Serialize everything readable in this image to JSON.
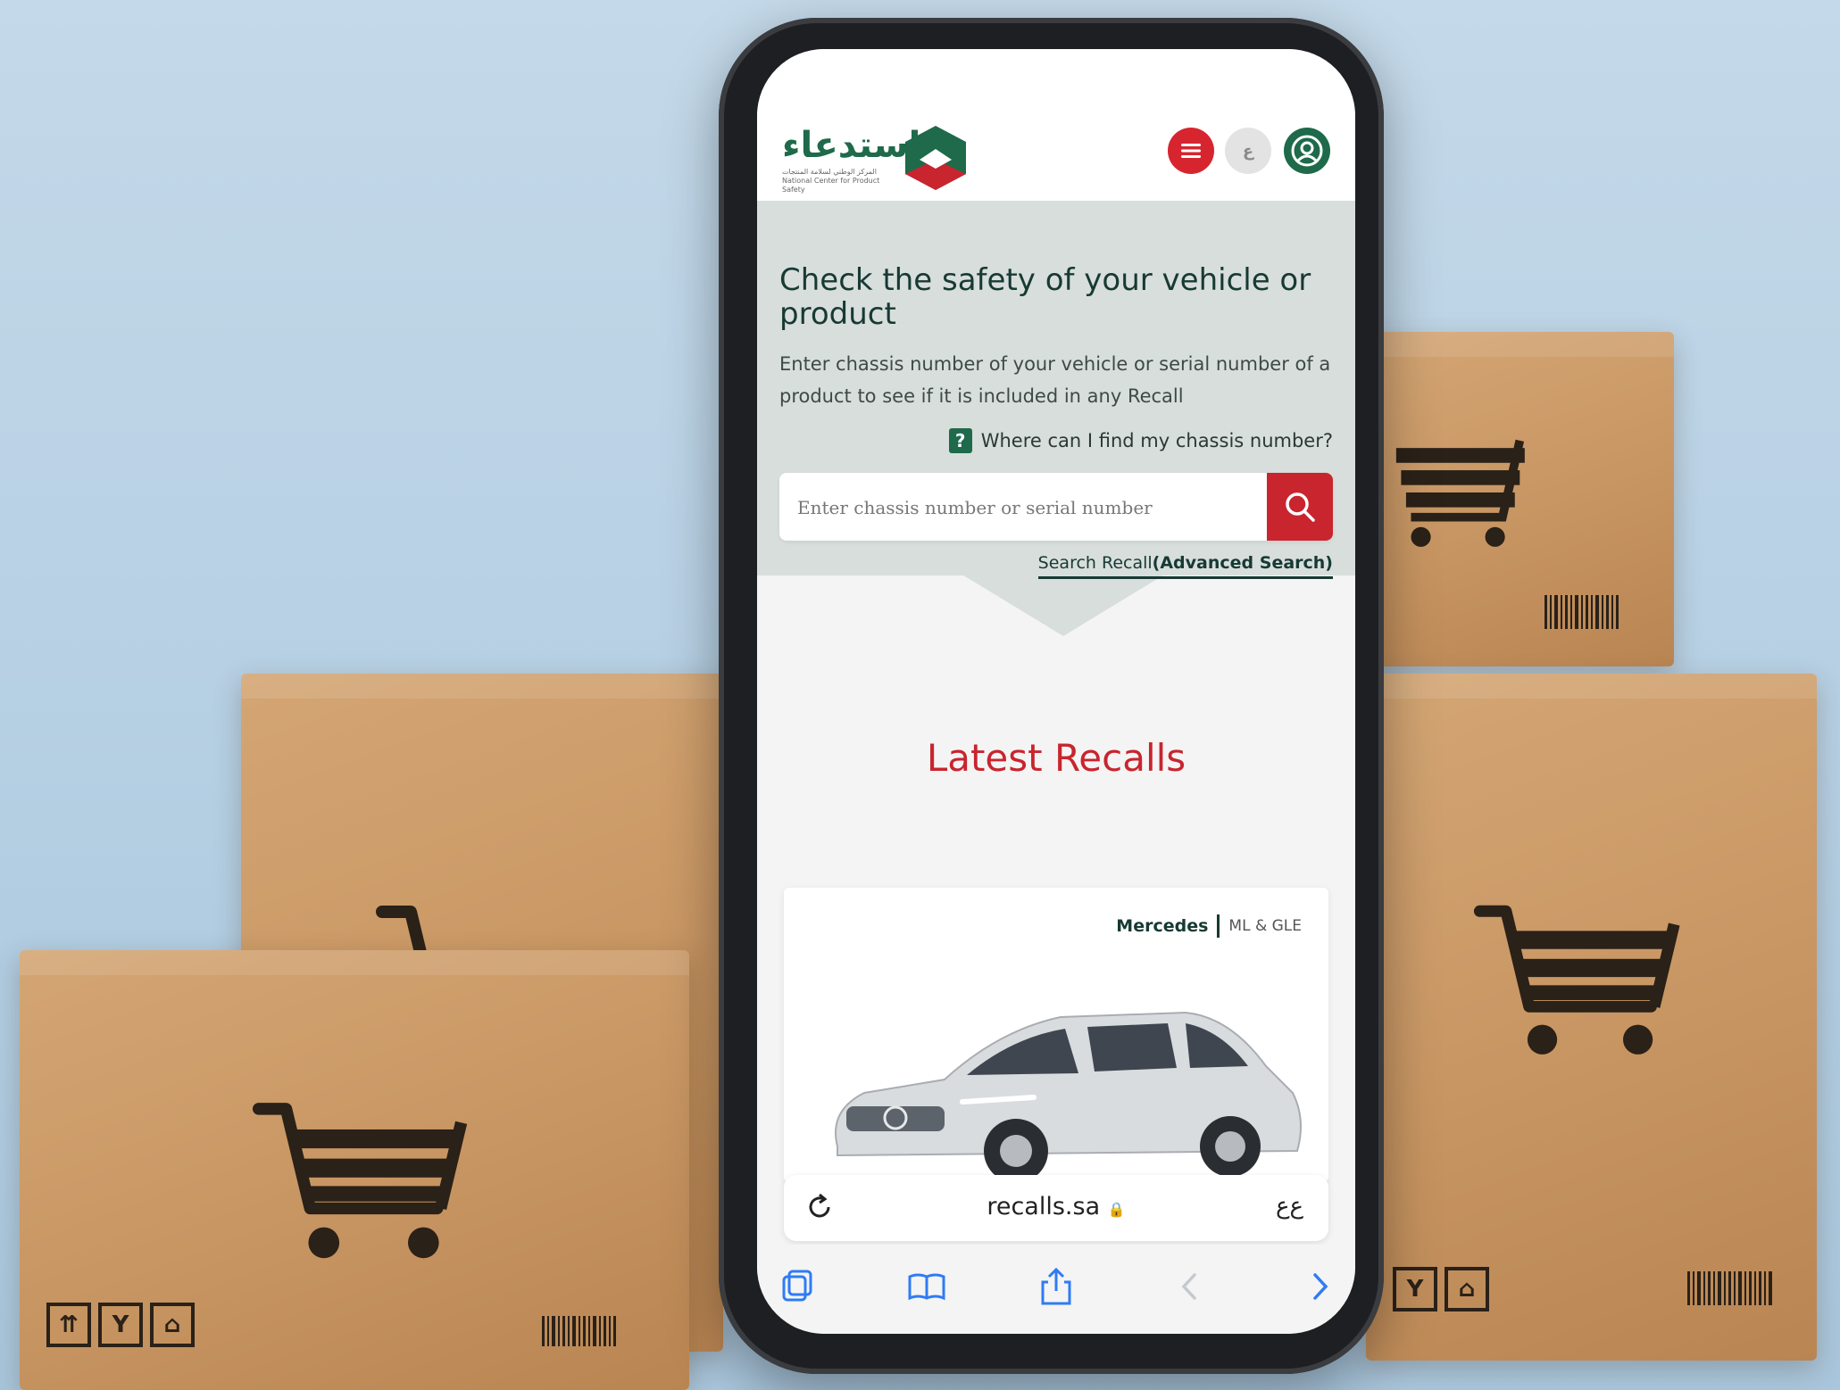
{
  "header": {
    "logo_text_ar": "استدعاء",
    "logo_subtitle": "المركز الوطني لسلامة المنتجات National Center for Product Safety",
    "menu_icon": "hamburger-menu-icon",
    "language_icon": "arabic-letter-icon",
    "user_icon": "user-profile-icon"
  },
  "hero": {
    "title": "Check the safety of your vehicle or product",
    "description": "Enter chassis number of your vehicle or serial number of a product to see if it is included in any Recall",
    "help_link": "Where can I find my chassis number?",
    "search_placeholder": "Enter chassis number or serial number",
    "advanced_search_prefix": "Search Recall",
    "advanced_search_label": "(Advanced Search)"
  },
  "latest": {
    "title": "Latest Recalls"
  },
  "recall_card": {
    "make": "Mercedes",
    "model": "ML & GLE"
  },
  "browser": {
    "url": "recalls.sa",
    "text_size_label": "ﻉﻉ",
    "icons": [
      "reload-icon",
      "lock-icon",
      "tabs-icon",
      "bookmarks-icon",
      "share-icon",
      "back-icon",
      "forward-icon"
    ]
  },
  "colors": {
    "brand_green": "#1e6a4b",
    "brand_red": "#c8252f",
    "hero_bg": "#d8dedc"
  }
}
